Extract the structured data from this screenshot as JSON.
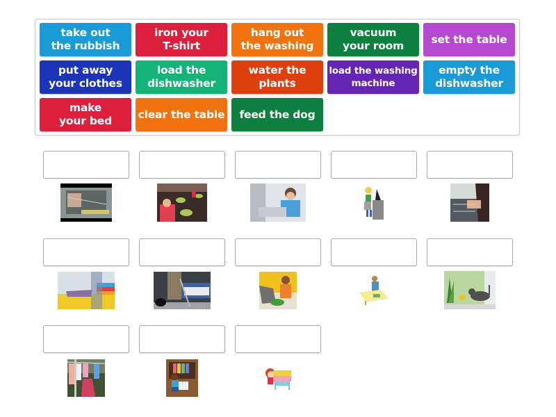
{
  "activity": "match-up",
  "tiles": [
    {
      "label": "take out\nthe rubbish",
      "color": "#1a9ad6"
    },
    {
      "label": "iron your\nT-shirt",
      "color": "#dc1f3c"
    },
    {
      "label": "hang out\nthe washing",
      "color": "#f07310"
    },
    {
      "label": "vacuum\nyour room",
      "color": "#0d8040"
    },
    {
      "label": "set the table",
      "color": "#b54ad0"
    },
    {
      "label": "put away\nyour clothes",
      "color": "#1c34b8"
    },
    {
      "label": "load the\ndishwasher",
      "color": "#14b37a"
    },
    {
      "label": "water the\nplants",
      "color": "#de3e10"
    },
    {
      "label": "load the washing\nmachine",
      "color": "#6424b4"
    },
    {
      "label": "empty the\ndishwasher",
      "color": "#1a9ad6"
    },
    {
      "label": "make\nyour bed",
      "color": "#dc1f3c"
    },
    {
      "label": "clear the table",
      "color": "#f07310"
    },
    {
      "label": "feed the dog",
      "color": "#0d8040"
    }
  ],
  "targets": [
    {
      "image": "loading-dishwasher-photo",
      "answer": ""
    },
    {
      "image": "clearing-table-photo",
      "answer": ""
    },
    {
      "image": "washing-machine-photo",
      "answer": ""
    },
    {
      "image": "taking-out-rubbish-cartoon",
      "answer": ""
    },
    {
      "image": "emptying-dishwasher-photo",
      "answer": ""
    },
    {
      "image": "ironing-photo",
      "answer": ""
    },
    {
      "image": "vacuuming-photo",
      "answer": ""
    },
    {
      "image": "feeding-dog-photo",
      "answer": ""
    },
    {
      "image": "setting-table-cartoon",
      "answer": ""
    },
    {
      "image": "watering-plants-photo",
      "answer": ""
    },
    {
      "image": "hanging-washing-photo",
      "answer": ""
    },
    {
      "image": "putting-away-clothes-cartoon",
      "answer": ""
    },
    {
      "image": "making-bed-cartoon",
      "answer": ""
    }
  ]
}
